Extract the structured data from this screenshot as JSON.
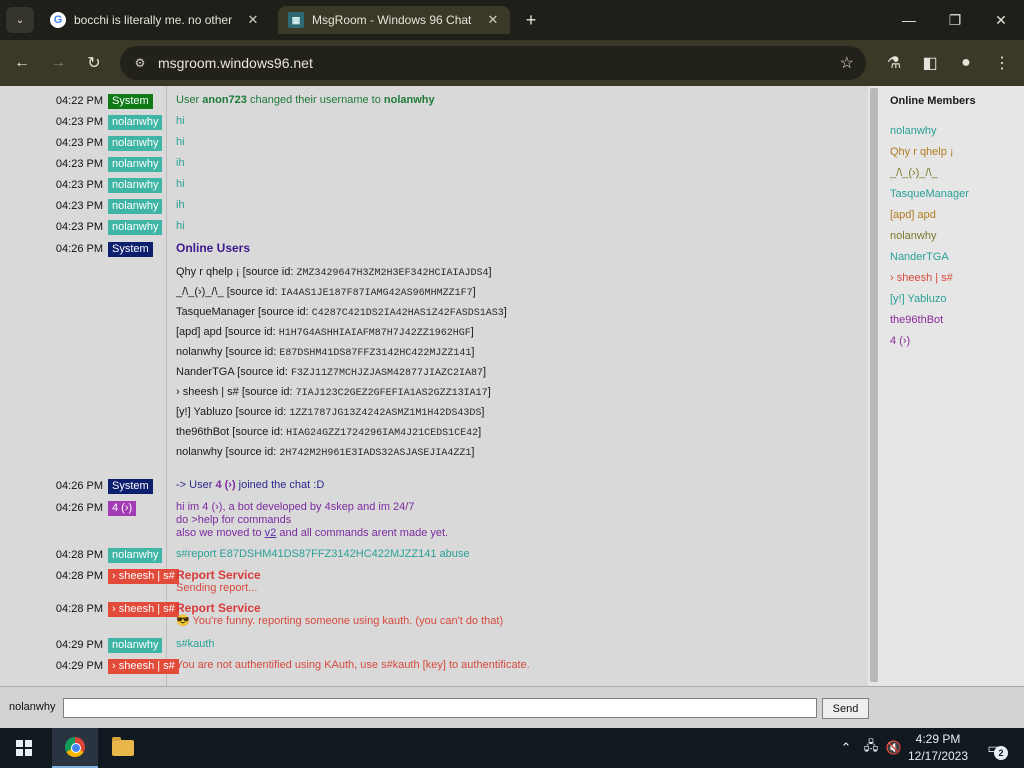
{
  "browser": {
    "tabs": [
      {
        "title": "bocchi is literally me. no other",
        "icon": "google-icon"
      },
      {
        "title": "MsgRoom - Windows 96 Chat",
        "icon": "msgroom-icon"
      }
    ],
    "url": "msgroom.windows96.net"
  },
  "chat": {
    "messages": [
      {
        "time": "04:22 PM",
        "user": "System",
        "parts": [
          "User ",
          "anon723",
          " changed their username to ",
          "nolanwhy"
        ]
      },
      {
        "time": "04:23 PM",
        "user": "nolanwhy",
        "text": "hi"
      },
      {
        "time": "04:23 PM",
        "user": "nolanwhy",
        "text": "hi"
      },
      {
        "time": "04:23 PM",
        "user": "nolanwhy",
        "text": "ih"
      },
      {
        "time": "04:23 PM",
        "user": "nolanwhy",
        "text": "hi"
      },
      {
        "time": "04:23 PM",
        "user": "nolanwhy",
        "text": "ih"
      },
      {
        "time": "04:23 PM",
        "user": "nolanwhy",
        "text": "hi"
      },
      {
        "time": "04:26 PM",
        "user": "System",
        "title": "Online Users"
      },
      {
        "time": "04:26 PM",
        "user": "System",
        "parts": [
          "-> User ",
          "4 (›)",
          " joined the chat :D"
        ]
      },
      {
        "time": "04:26 PM",
        "user": "4 (›)",
        "lines": [
          "hi im 4 (›), a bot developed by 4skep and im 24/7",
          "do >help for commands",
          "also we moved to ",
          "v2",
          " and all commands arent made yet."
        ]
      },
      {
        "time": "04:28 PM",
        "user": "nolanwhy",
        "text": "s#report E87DSHM41DS87FFZ3142HC422MJZZ141 abuse"
      },
      {
        "time": "04:28 PM",
        "user": "› sheesh | s#",
        "title": "Report Service",
        "text": "Sending report..."
      },
      {
        "time": "04:28 PM",
        "user": "› sheesh | s#",
        "title": "Report Service",
        "text": "😎 You're funny. reporting someone using kauth. (you can't do that)"
      },
      {
        "time": "04:29 PM",
        "user": "nolanwhy",
        "text": "s#kauth"
      },
      {
        "time": "04:29 PM",
        "user": "› sheesh | s#",
        "text": "You are not authentified using KAuth, use s#kauth [key] to authentificate."
      }
    ],
    "online_users": [
      {
        "name": "Qhy r qhelp ¡",
        "sid": "ZMZ3429647H3ZM2H3EF342HCIAIAJDS4"
      },
      {
        "name": "_/\\_(›)_/\\_",
        "sid": "IA4AS1JE187F87IAMG42AS96MHMZZ1F7"
      },
      {
        "name": "TasqueManager",
        "sid": "C4287C421DS2IA42HAS1Z42FASDS1AS3"
      },
      {
        "name": "[apd] apd",
        "sid": "H1H7G4ASHHIAIAFM87H7J42ZZ1962HGF"
      },
      {
        "name": "nolanwhy",
        "sid": "E87DSHM41DS87FFZ3142HC422MJZZ141"
      },
      {
        "name": "NanderTGA",
        "sid": "F3ZJ11Z7MCHJZJASM42877JIAZC2IA87"
      },
      {
        "name": "› sheesh | s#",
        "sid": "7IAJ123C2GEZ2GFEFIA1AS2GZZ13IA17"
      },
      {
        "name": "[y!] Yabluzo",
        "sid": "1ZZ1787JG13Z4242ASMZ1M1H42DS43DS"
      },
      {
        "name": "the96thBot",
        "sid": "HIAG24GZZ1724296IAM4J21CEDS1CE42"
      },
      {
        "name": "nolanwhy",
        "sid": "2H742M2H961E3IADS32ASJASEJIA4ZZ1"
      }
    ],
    "source_id_prefix": "[source id: ",
    "source_id_suffix": "]"
  },
  "members": {
    "heading": "Online Members",
    "list": [
      "nolanwhy",
      "Qhy r qhelp ¡",
      "_/\\_(›)_/\\_",
      "TasqueManager",
      "[apd] apd",
      "nolanwhy",
      "NanderTGA",
      "› sheesh | s#",
      "[y!] Yabluzo",
      "the96thBot",
      "4 (›)"
    ]
  },
  "composer": {
    "nickname": "nolanwhy",
    "input_value": "",
    "send_label": "Send"
  },
  "taskbar": {
    "time": "4:29 PM",
    "date": "12/17/2023",
    "notifications": "2"
  }
}
